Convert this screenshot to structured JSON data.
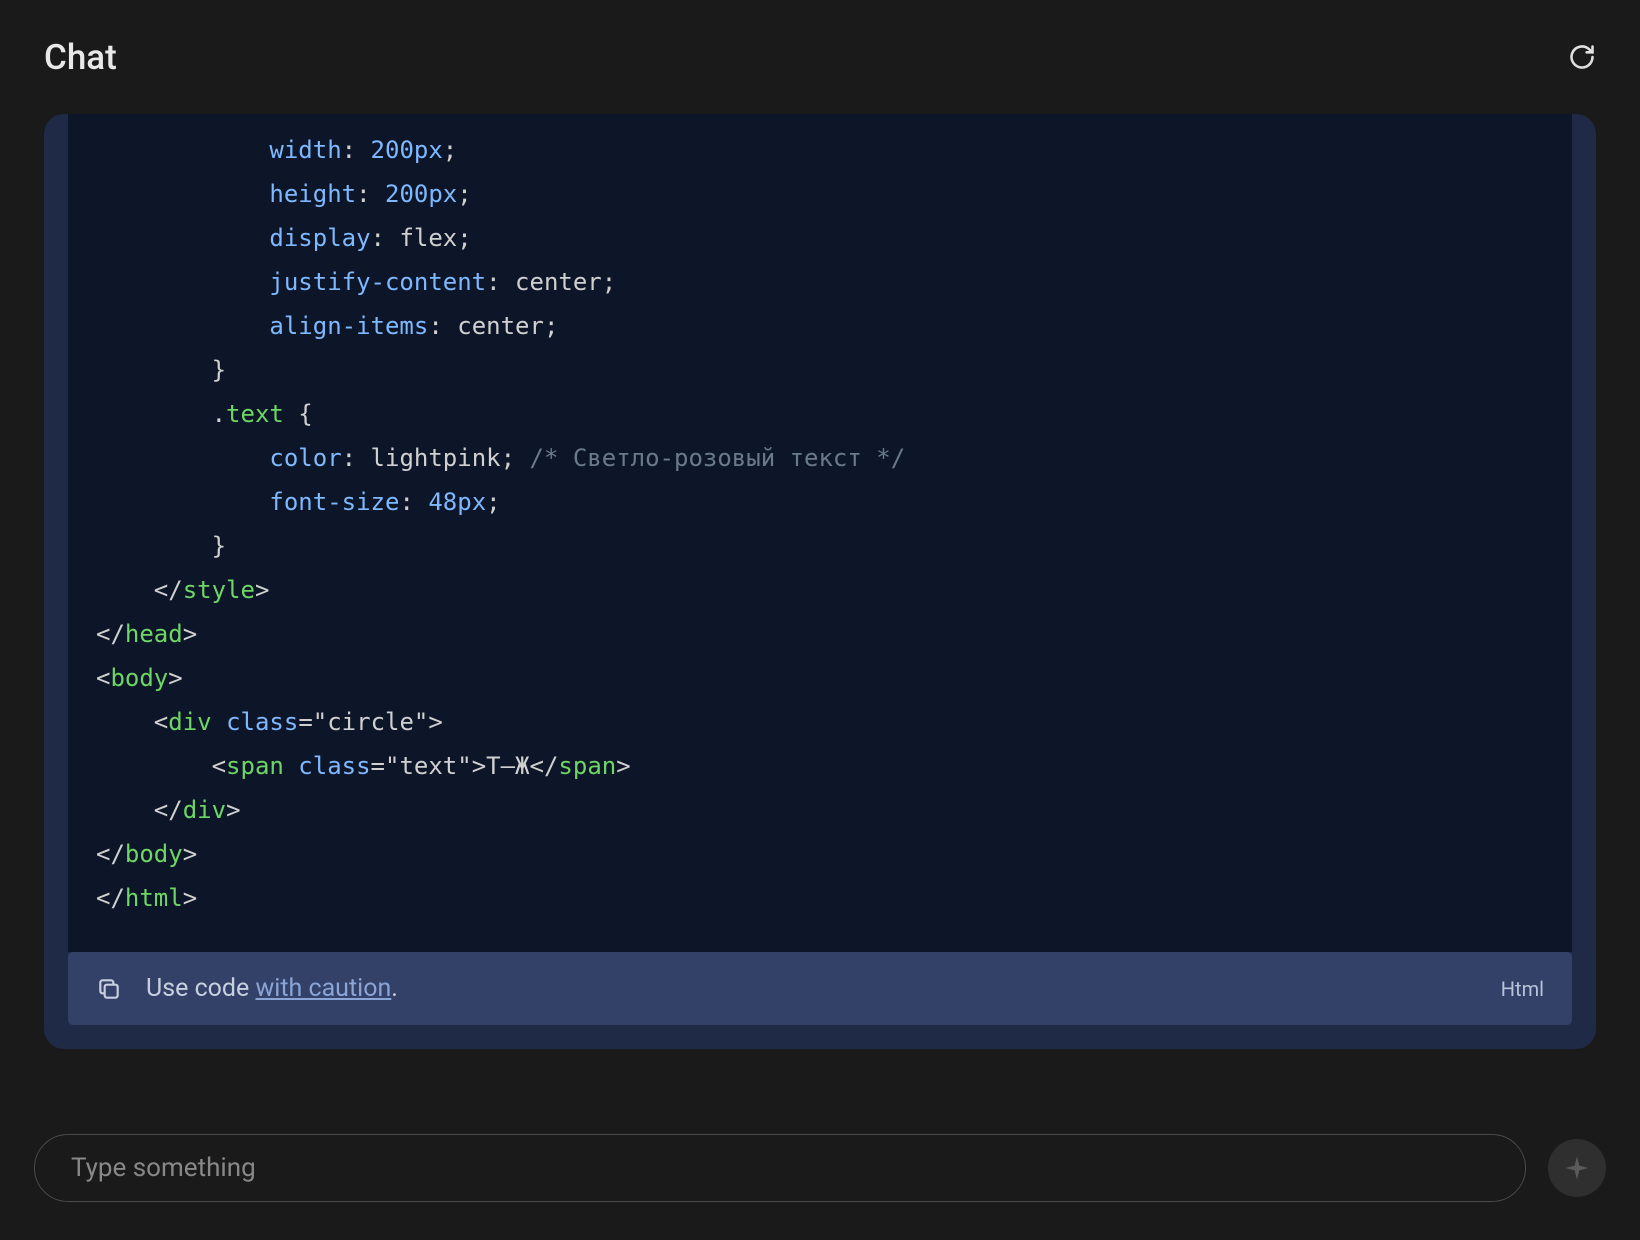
{
  "header": {
    "title": "Chat"
  },
  "code": {
    "lines": [
      {
        "indent": 6,
        "prop": "width",
        "val": "200px"
      },
      {
        "indent": 6,
        "prop": "height",
        "val": "200px"
      },
      {
        "indent": 6,
        "prop": "display",
        "val_plain": "flex"
      },
      {
        "indent": 6,
        "prop": "justify-content",
        "val_plain": "center"
      },
      {
        "indent": 6,
        "prop": "align-items",
        "val_plain": "center"
      },
      {
        "indent": 4,
        "brace": "}"
      },
      {
        "indent": 4,
        "selector": ".text",
        "open": "{"
      },
      {
        "indent": 6,
        "prop": "color",
        "val_plain": "lightpink",
        "comment": "/* Светло-розовый текст */"
      },
      {
        "indent": 6,
        "prop": "font-size",
        "val": "48px"
      },
      {
        "indent": 4,
        "brace": "}"
      },
      {
        "indent": 2,
        "close_tag": "style"
      },
      {
        "indent": 0,
        "close_tag": "head"
      },
      {
        "indent": 0,
        "open_tag": "body"
      },
      {
        "indent": 2,
        "open_tag_attr": "div",
        "attr": "class",
        "attr_val": "\"circle\""
      },
      {
        "indent": 4,
        "span_line": {
          "tag": "span",
          "attr": "class",
          "attr_val": "\"text\"",
          "inner": "Т—Ж"
        }
      },
      {
        "indent": 2,
        "close_tag": "div"
      },
      {
        "indent": 0,
        "close_tag": "body"
      },
      {
        "indent": 0,
        "close_tag": "html"
      }
    ]
  },
  "caution": {
    "prefix": "Use code ",
    "link": "with caution",
    "suffix": ".",
    "lang": "Html"
  },
  "input": {
    "placeholder": "Type something"
  }
}
